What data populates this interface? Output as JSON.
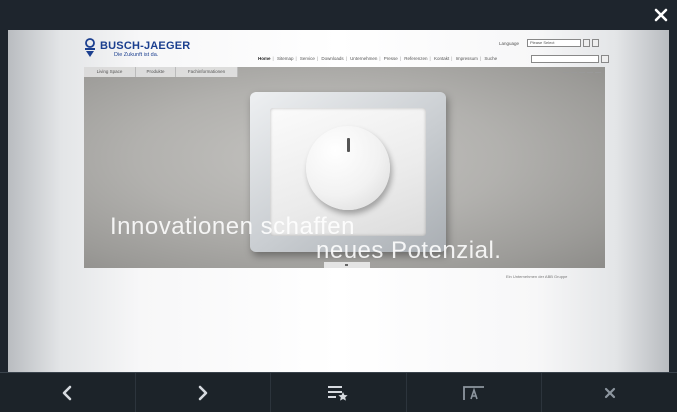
{
  "window": {
    "close_icon": "close-icon"
  },
  "site": {
    "brand_name": "BUSCH-JAEGER",
    "tagline": "Die Zukunft ist da.",
    "language_label": "Language",
    "language_select_value": "Please Select",
    "nav": [
      "Home",
      "Sitemap",
      "Service",
      "Downloads",
      "Unternehmen",
      "Presse",
      "Referenzen",
      "Kontakt",
      "Impressum",
      "Suche"
    ],
    "hero_tabs": [
      "Living Space",
      "Produkte",
      "Fachinformationen"
    ],
    "hero_headline_1": "Innovationen schaffen",
    "hero_headline_2": "neues Potenzial.",
    "footer_note": "Ein Unternehmen der ABB Gruppe"
  },
  "toolbar": {
    "buttons": [
      {
        "icon": "chevron-left-icon"
      },
      {
        "icon": "chevron-right-icon"
      },
      {
        "icon": "bookmarks-icon"
      },
      {
        "icon": "text-size-icon"
      },
      {
        "icon": "close-icon"
      }
    ],
    "colors": {
      "icon": "#d6dadf",
      "background": "#1c2329"
    }
  }
}
